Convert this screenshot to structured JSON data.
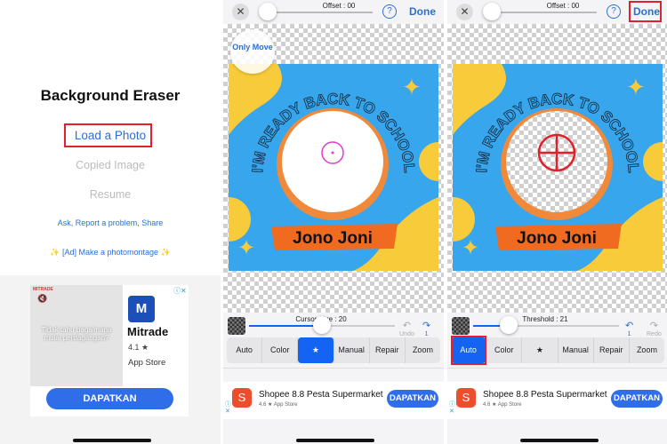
{
  "home": {
    "title": "Background Eraser",
    "load_photo": "Load a Photo",
    "copied_image": "Copied Image",
    "resume": "Resume",
    "ask_link": "Ask, Report a problem, Share",
    "photomontage": "✨ [Ad] Make a photomontage ✨",
    "ad": {
      "brand_tag": "MITRADE",
      "image_text": "Tidak tahu bagaimana mulai perdagangan?",
      "app_name": "Mitrade",
      "rating": "4.1 ★",
      "store": "App Store",
      "cta": "DAPATKAN"
    }
  },
  "editor": {
    "close_icon": "✕",
    "offset_label": "Offset : 00",
    "offset_value": 0,
    "help": "?",
    "done": "Done",
    "only_move": "Only Move",
    "picture": {
      "arc_text": "I'M READY BACK TO SCHOOL",
      "banner": "Jono Joni"
    },
    "modes": [
      "Auto",
      "Color",
      "★",
      "Manual",
      "Repair",
      "Zoom"
    ],
    "undo": "Undo",
    "redo": "Redo",
    "count": "1",
    "ad": {
      "app_name": "Shopee 8.8 Pesta Supermarket",
      "rating": "4.6 ★",
      "store": "App Store",
      "cta": "DAPATKAN"
    }
  },
  "screen2": {
    "slider_label": "Cursor Size : 20",
    "slider_value": 20,
    "active_mode": "★"
  },
  "screen3": {
    "slider_label": "Threshold : 21",
    "slider_value": 21,
    "active_mode": "Auto"
  },
  "colors": {
    "accent": "#2a6fd6",
    "active_mode": "#1463f3",
    "highlight": "#e0202a"
  }
}
